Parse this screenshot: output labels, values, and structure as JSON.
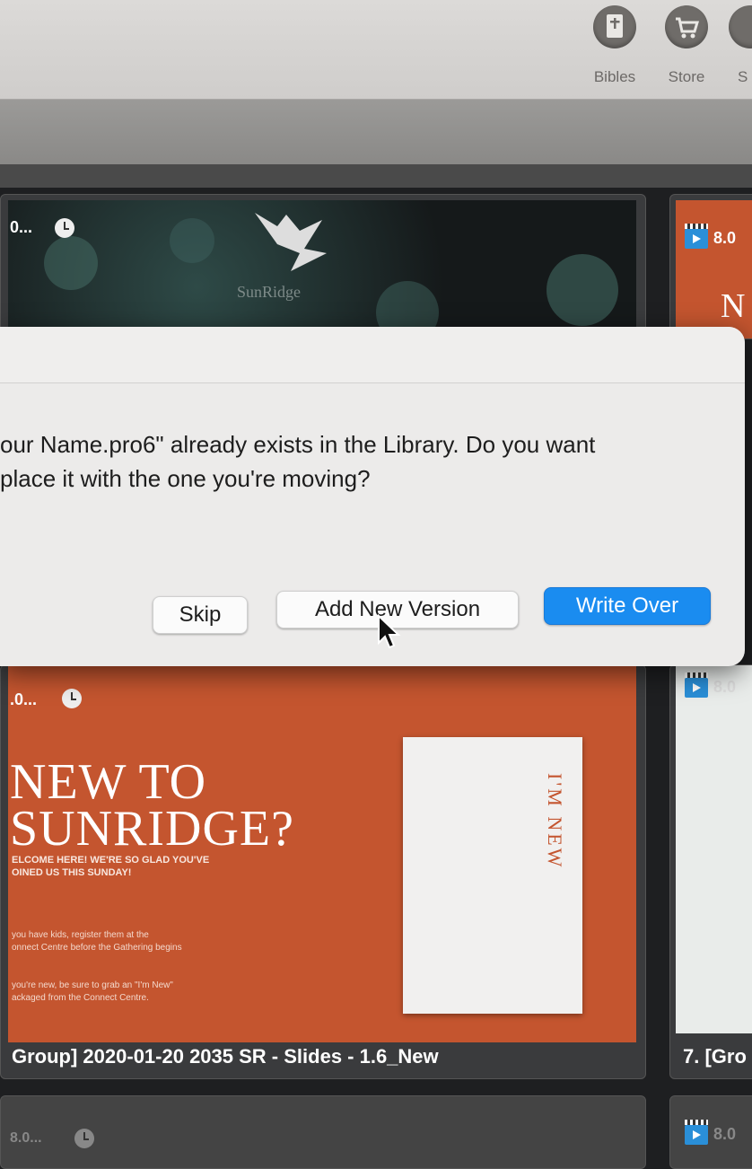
{
  "toolbar": {
    "bibles_label": "Bibles",
    "store_label": "Store",
    "partial_label": "S"
  },
  "cards": {
    "top_left": {
      "badge": "0...",
      "logo_text": "SunRidge"
    },
    "top_right": {
      "badge": "8.0",
      "slide_letter": "N"
    },
    "middle_left": {
      "badge": ".0...",
      "slide_title": "NEW TO\nSUNRIDGE?",
      "slide_welcome": "ELCOME HERE! WE'RE SO GLAD YOU'VE\nOINED US THIS SUNDAY!",
      "slide_kids": "you have kids, register them at the\nonnect Centre before the Gathering begins",
      "slide_new": "you're new, be sure to grab an \"I'm New\"\nackaged from the Connect Centre.",
      "paper_text": "I'M NEW",
      "caption": "Group] 2020-01-20 2035 SR - Slides - 1.6_New"
    },
    "middle_right": {
      "badge": "8.0",
      "caption": "7. [Gro"
    },
    "bottom_left": {
      "badge": "8.0..."
    },
    "bottom_right": {
      "badge": "8.0"
    }
  },
  "dialog": {
    "message": "our Name.pro6\" already exists in the Library. Do you want\nplace it with the one you're moving?",
    "skip_label": "Skip",
    "add_version_label": "Add New Version",
    "write_over_label": "Write Over"
  },
  "colors": {
    "accent": "#1a8cf0",
    "slide_orange": "#c4552f"
  }
}
